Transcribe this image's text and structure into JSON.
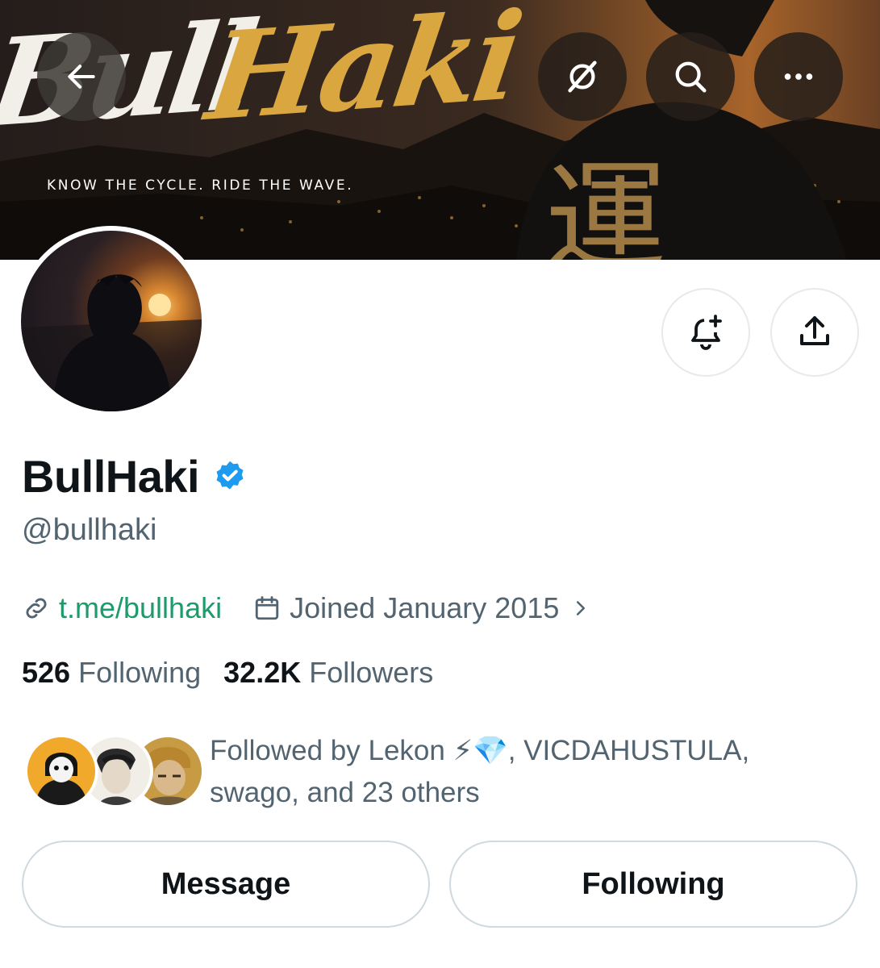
{
  "banner": {
    "logo_part1": "Bull",
    "logo_part2": "Haki",
    "tagline": "KNOW THE CYCLE. RIDE THE WAVE.",
    "accent_color": "#d9a640"
  },
  "toolbar": {
    "back_icon": "arrow-left-icon",
    "grok_icon": "grok-icon",
    "search_icon": "search-icon",
    "more_icon": "more-dots-icon"
  },
  "profile": {
    "display_name": "BullHaki",
    "handle": "@bullhaki",
    "verified_color": "#1d9bf0",
    "link": "t.me/bullhaki",
    "joined": "Joined January 2015",
    "following_count": "526",
    "following_label": "Following",
    "followers_count": "32.2K",
    "followers_label": "Followers"
  },
  "followed_by": {
    "line1": "Followed by Lekon ⚡💎, VICDAHUSTULA,",
    "line2": "swago, and 23 others"
  },
  "actions": {
    "message_label": "Message",
    "following_label": "Following",
    "notify_icon": "bell-plus-icon",
    "share_icon": "share-icon"
  },
  "colors": {
    "link": "#1d9b6a",
    "secondary_text": "#536471",
    "primary_text": "#0f1419"
  }
}
